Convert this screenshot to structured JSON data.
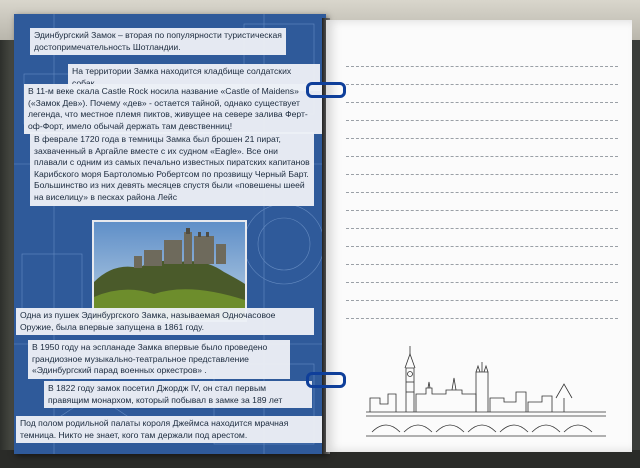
{
  "left_page": {
    "notes": [
      "Эдинбургский Замок – вторая по популярности туристическая достопримечательность Шотландии.",
      "На территории Замка находится кладбище солдатских собак.",
      "В 11-м веке скала Castle Rock носила название «Castle of Maidens» («Замок Дев»). Почему «дев» - остается тайной, однако существует легенда, что местное племя пиктов, живущее на севере залива Ферт-оф-Форт, имело обычай держать там девственниц!",
      "В феврале 1720 года в темницы Замка был брошен 21 пират, захваченный в Аргайле вместе с их судном «Eagle». Все они плавали с одним из самых печально известных пиратских капитанов Карибского моря Бартоломью Робертсом по прозвищу Черный Барт. Большинство из них девять месяцев спустя были «повешены шеей на виселицу» в песках района Лейс",
      "Одна из пушек Эдинбургского Замка, называемая Одночасовое Оружие, была впервые запущена в 1861 году.",
      "В 1950 году на эспланаде Замка впервые было проведено грандиозное музыкально-театральное представление «Эдинбургский парад военных оркестров» .",
      "В 1822 году замок посетил Джордж IV, он стал первым правящим монархом, который побывал в замке за 189 лет",
      "Под полом родильной палаты короля Джеймса находится мрачная темница. Никто не знает, кого там держали под арестом."
    ]
  },
  "right_page": {
    "line_count": 15,
    "sketch": "london-skyline-sketch"
  },
  "colors": {
    "left_page": "#2f5a9a",
    "note_background": "#eceff6",
    "ring": "#0f3f9a",
    "right_page": "#fbfbfb"
  }
}
